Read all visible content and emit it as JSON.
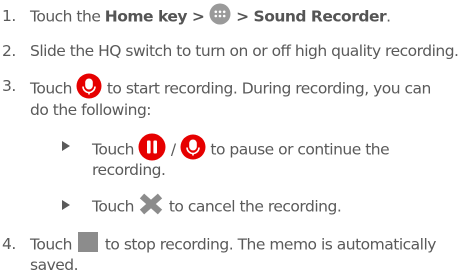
{
  "steps": [
    {
      "number": "1.",
      "part1": "Touch the ",
      "home_key": "Home",
      "part2": " key > ",
      "part3": " > ",
      "app_name": "Sound Recorder",
      "part4": "."
    },
    {
      "number": "2.",
      "text": "Slide the HQ switch to turn on or off high quality recording."
    },
    {
      "number": "3.",
      "part1": "Touch ",
      "part2": " to start recording. During recording, you can",
      "line2": "do the following:",
      "bullets": [
        {
          "part1": "Touch ",
          "slash": " / ",
          "part2": " to pause or continue the",
          "line2": "recording."
        },
        {
          "part1": "Touch ",
          "part2": " to cancel the recording."
        }
      ]
    },
    {
      "number": "4.",
      "part1": "Touch ",
      "part2": " to stop recording. The memo is automatically",
      "line2": "saved."
    }
  ],
  "icons": {
    "apps": "apps-grid-icon",
    "record": "microphone-record-icon",
    "pause": "pause-icon",
    "cancel": "cancel-x-icon",
    "stop": "stop-square-icon",
    "bullet": "triangle-bullet-icon"
  },
  "colors": {
    "text": "#5a5a5a",
    "accent_red": "#e60000",
    "apps_icon_gray": "#9a9a9a",
    "stop_gray": "#8c8c8c",
    "cancel_gray": "#8c8c8c"
  }
}
